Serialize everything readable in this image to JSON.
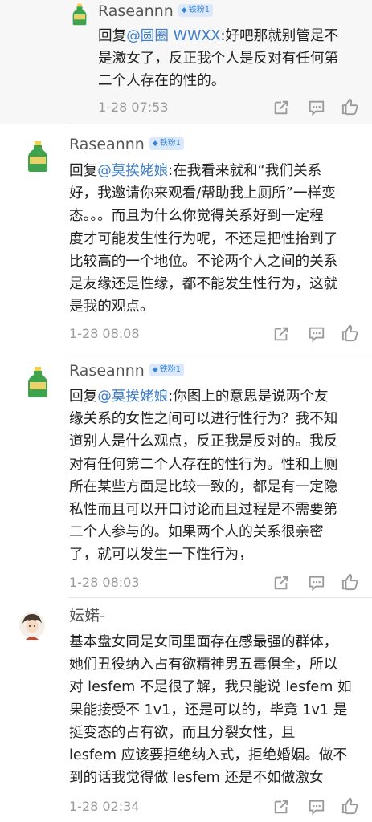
{
  "comments": [
    {
      "username": "Raseannn",
      "badge": "铁粉1",
      "lines": [
        {
          "prefix": "回复",
          "mention": "@圆圈 WWXX",
          "text": ":好吧那就别管是不"
        },
        {
          "text": "是激女了，反正我个人是反对有任何第"
        },
        {
          "text": "二个人存在的性的。"
        }
      ],
      "timestamp": "1-28 07:53"
    },
    {
      "username": "Raseannn",
      "badge": "铁粉1",
      "lines": [
        {
          "prefix": "回复",
          "mention": "@莫挨姥娘",
          "text": ":在我看来就和“我们关系"
        },
        {
          "text": "好，我邀请你来观看/帮助我上厕所”一样变"
        },
        {
          "text": "态。。。而且为什么你觉得关系好到一定程"
        },
        {
          "text": "度才可能发生性行为呢，不还是把性抬到了"
        },
        {
          "text": "比较高的一个地位。不论两个人之间的关系"
        },
        {
          "text": "是友缘还是性缘，都不能发生性行为，这就"
        },
        {
          "text": "是我的观点。"
        }
      ],
      "timestamp": "1-28 08:08"
    },
    {
      "username": "Raseannn",
      "badge": "铁粉1",
      "lines": [
        {
          "prefix": "回复",
          "mention": "@莫挨姥娘",
          "text": ":你图上的意思是说两个友"
        },
        {
          "text": "缘关系的女性之间可以进行性行为？我不知"
        },
        {
          "text": "道别人是什么观点，反正我是反对的。我反"
        },
        {
          "text": "对有任何第二个人存在的性行为。性和上厕"
        },
        {
          "text": "所在某些方面是比较一致的，都是有一定隐"
        },
        {
          "text": "私性而且可以开口讨论而且过程是不需要第"
        },
        {
          "text": "二个人参与的。如果两个人的关系很亲密"
        },
        {
          "text": "了，就可以发生一下性行为，"
        }
      ],
      "timestamp": "1-28 08:03"
    },
    {
      "username": "妘婼-",
      "badge": "",
      "lines": [
        {
          "text": "基本盘女同是女同里面存在感最强的群体，"
        },
        {
          "text": "她们丑役纳入占有欲精神男五毒俱全，所以"
        },
        {
          "text": "对 lesfem 不是很了解，我只能说 lesfem 如"
        },
        {
          "text": "果能接受不 1v1，还是可以的，毕竟 1v1 是"
        },
        {
          "text": "挺变态的占有欲，而且分裂女性，且"
        },
        {
          "text": "lesfem 应该要拒绝纳入式，拒绝婚姻。做不"
        },
        {
          "text": "到的话我觉得做 lesfem 还是不如做激女"
        }
      ],
      "timestamp": "1-28 02:34"
    }
  ],
  "icons": {
    "avatar_bottle": "bottle-avatar-icon",
    "avatar_person": "person-avatar-icon",
    "share": "share-icon",
    "comment": "comment-icon",
    "like": "thumbs-up-icon",
    "badge_diamond": "diamond-icon"
  },
  "colors": {
    "mention": "#3e7fc9",
    "badge_bg": "#dbe9fa",
    "badge_text": "#3a84d6",
    "timestamp": "#9a9a9a"
  }
}
